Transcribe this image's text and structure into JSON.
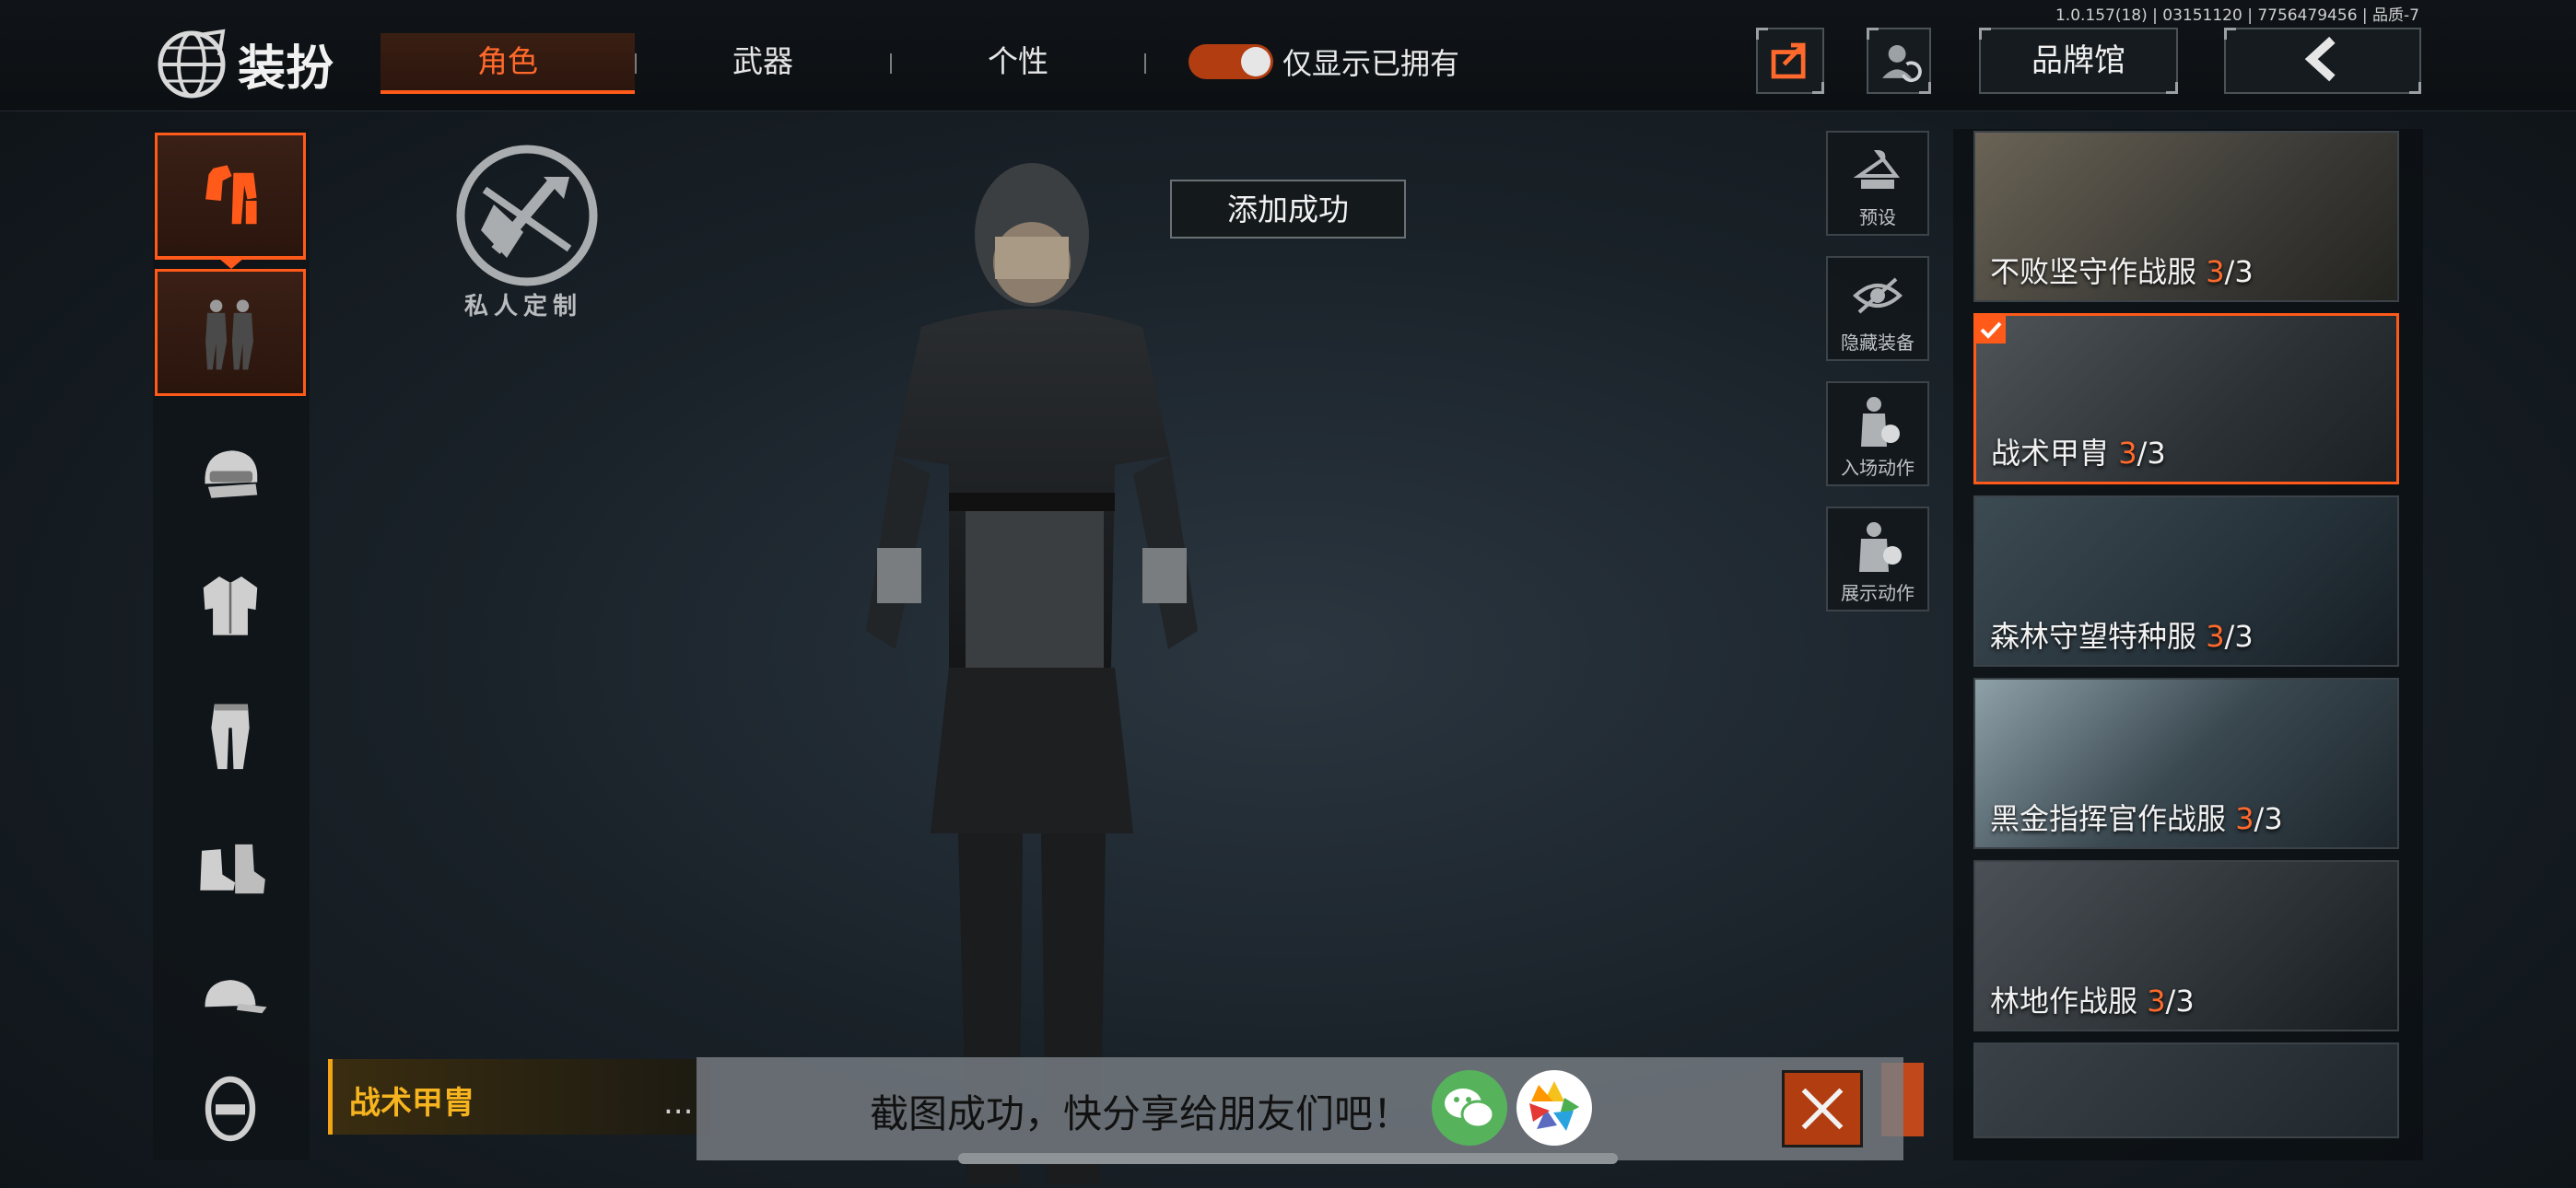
{
  "version": "1.0.157(18) | 03151120 | 7756479456 | 品质-7",
  "header": {
    "title": "装扮",
    "tabs": [
      {
        "label": "角色",
        "active": true
      },
      {
        "label": "武器",
        "active": false
      },
      {
        "label": "个性",
        "active": false
      }
    ],
    "toggle": {
      "label": "仅显示已拥有",
      "on": true
    },
    "brand_button": "品牌馆"
  },
  "left_slots": [
    {
      "icon": "outfit-icon",
      "selected": true
    },
    {
      "icon": "full-suit-icon",
      "selected": true
    },
    {
      "icon": "helmet-icon"
    },
    {
      "icon": "shirt-icon"
    },
    {
      "icon": "pants-icon"
    },
    {
      "icon": "boots-icon"
    },
    {
      "icon": "cap-icon"
    },
    {
      "icon": "mask-icon"
    }
  ],
  "custom": {
    "label": "私人定制"
  },
  "toast": "添加成功",
  "quick_actions": [
    {
      "label": "预设",
      "icon": "hanger-icon"
    },
    {
      "label": "隐藏装备",
      "icon": "hide-eye-icon"
    },
    {
      "label": "入场动作",
      "icon": "entrance-emote-icon"
    },
    {
      "label": "展示动作",
      "icon": "display-emote-icon"
    }
  ],
  "outfits": [
    {
      "name": "不败坚守作战服",
      "owned": "3",
      "total": "/3",
      "selected": false
    },
    {
      "name": "战术甲胄",
      "owned": "3",
      "total": "/3",
      "selected": true
    },
    {
      "name": "森林守望特种服",
      "owned": "3",
      "total": "/3",
      "selected": false
    },
    {
      "name": "黑金指挥官作战服",
      "owned": "3",
      "total": "/3",
      "selected": false
    },
    {
      "name": "林地作战服",
      "owned": "3",
      "total": "/3",
      "selected": false
    },
    {
      "name": "",
      "owned": "",
      "total": "",
      "selected": false
    }
  ],
  "current_item": "战术甲胄",
  "more": "...",
  "share": {
    "text": "截图成功，快分享给朋友们吧！"
  },
  "colors": {
    "accent": "#ff5a1a",
    "gold": "#f6b41e"
  }
}
